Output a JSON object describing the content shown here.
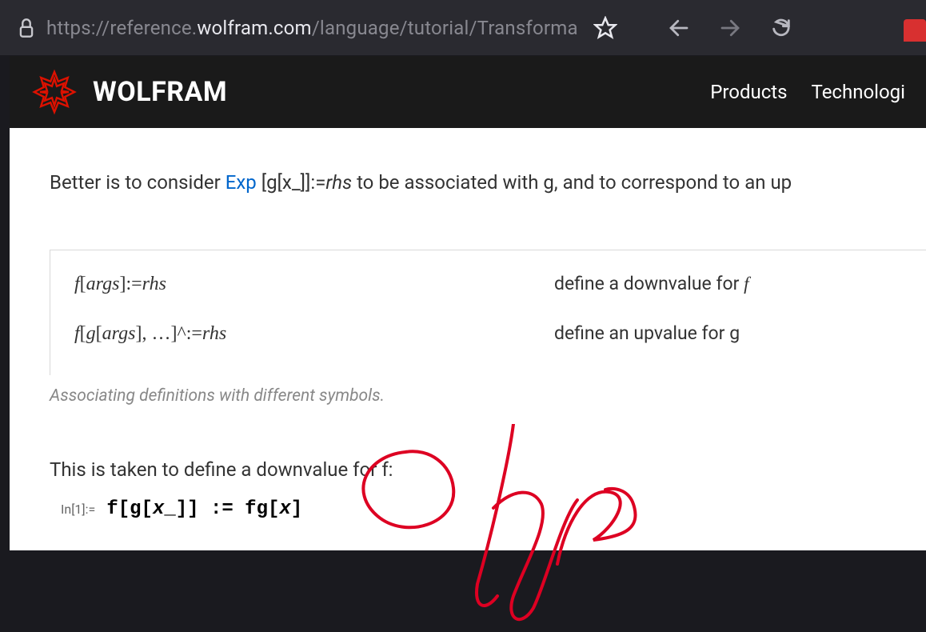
{
  "browser": {
    "url_prefix": "https://reference.",
    "url_host": "wolfram.com",
    "url_path": "/language/tutorial/Transforma"
  },
  "site": {
    "brand": "WOLFRAM",
    "nav": [
      "Products",
      "Technologi"
    ]
  },
  "intro": {
    "pre": "Better is to consider ",
    "link": "Exp",
    "code_open": " [",
    "code_inner1": "g",
    "code_inner2": "[",
    "code_inner3": "x_",
    "code_inner4": "]",
    "code_inner5": "]",
    "assign": ":=",
    "rhs": "rhs",
    "post": " to be associated with ",
    "gvar": "g",
    "rest": ", and to correspond to an up"
  },
  "table": {
    "rows": [
      {
        "lhs_f": "f",
        "lhs_rest": "[",
        "lhs_args": "args",
        "lhs_close": "]:=",
        "lhs_rhs": "rhs",
        "desc_pre": "define a downvalue for ",
        "desc_sym": "f"
      },
      {
        "lhs_f": "f",
        "lhs_rest": "[",
        "lhs_g": "g",
        "lhs_rest2": "[",
        "lhs_args": "args",
        "lhs_close": "], …]^:=",
        "lhs_rhs": "rhs",
        "desc_pre": "define an upvalue for ",
        "desc_sym": "g"
      }
    ],
    "caption": "Associating definitions with different symbols."
  },
  "sentence": {
    "pre": "This is taken to define a downvalue for ",
    "sym": "f",
    "post": ":"
  },
  "cell": {
    "label": "In[1]:=",
    "code_pre": "f[g[",
    "code_x": "x",
    "code_mid": "_]] := fg[",
    "code_x2": "x",
    "code_end": "]"
  },
  "annotation": {
    "text": "typo"
  }
}
